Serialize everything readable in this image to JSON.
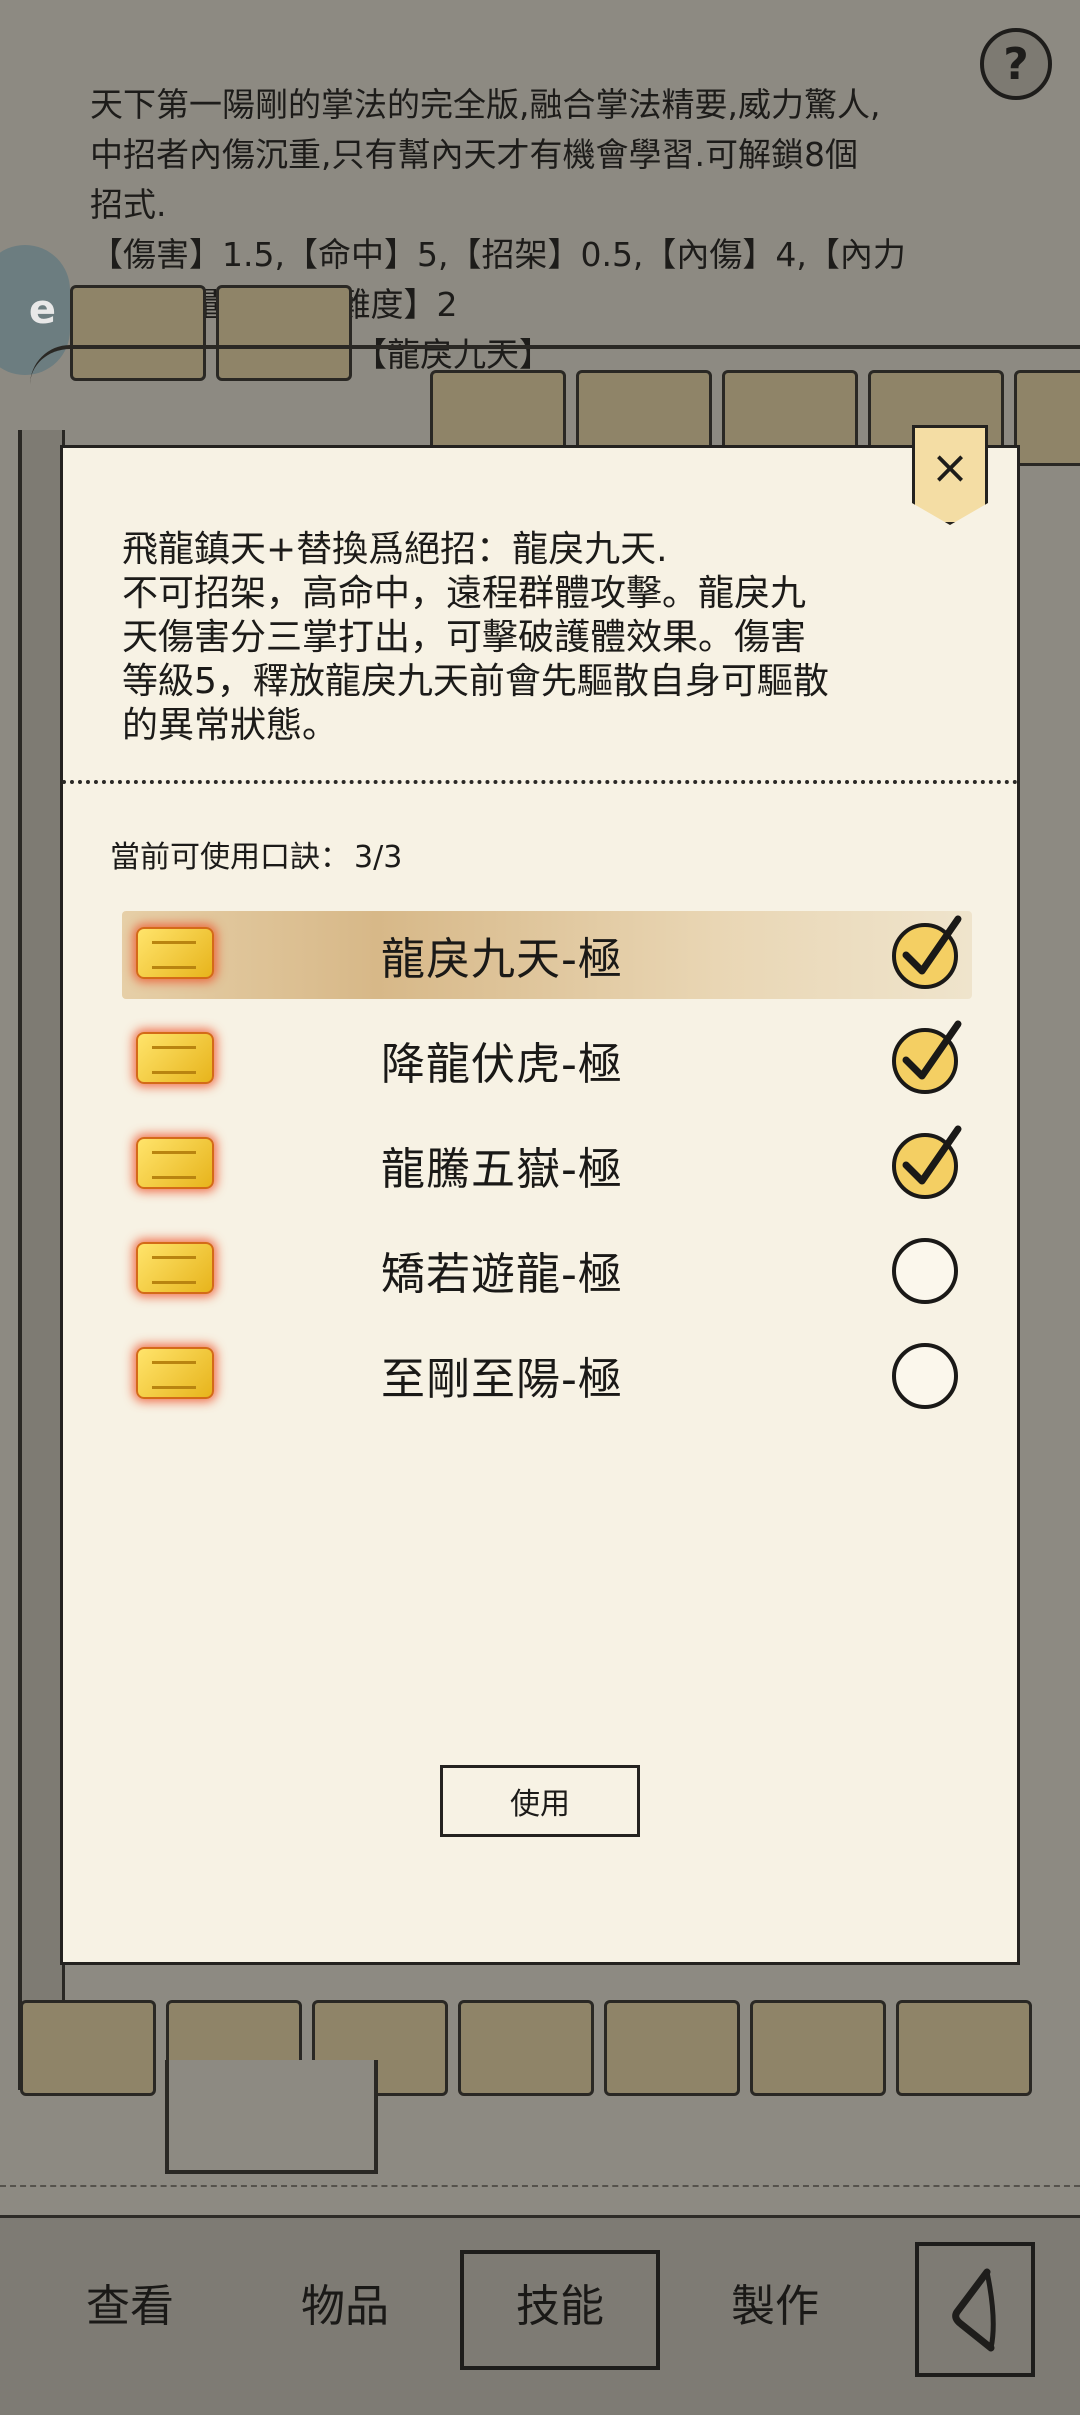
{
  "background": {
    "description_lines": [
      "天下第一陽剛的掌法的完全版,融合掌法精要,威力驚人,",
      "中招者內傷沉重,只有幫內天才有機會學習.可解鎖8個",
      "招式.",
      "【傷害】1.5,【命中】5,【招架】0.5,【內傷】4,【內力",
      "　　　量　【領悟難度】2",
      "　　　　　　岳】　【龍戾九天】"
    ],
    "help_label": "?",
    "side_badge_label": "e"
  },
  "dialog": {
    "close_label": "×",
    "description": [
      "飛龍鎮天+替換爲絕招：龍戾九天.",
      "不可招架，高命中，遠程群體攻擊。龍戾九",
      "天傷害分三掌打出，可擊破護體效果。傷害",
      "等級5，釋放龍戾九天前會先驅散自身可驅散",
      "的異常狀態。"
    ],
    "quota_label": "當前可使用口訣：",
    "quota_value": "3/3",
    "skills": [
      {
        "name": "龍戾九天-極",
        "checked": true,
        "highlighted": true
      },
      {
        "name": "降龍伏虎-極",
        "checked": true,
        "highlighted": false
      },
      {
        "name": "龍騰五嶽-極",
        "checked": true,
        "highlighted": false
      },
      {
        "name": "矯若遊龍-極",
        "checked": false,
        "highlighted": false
      },
      {
        "name": "至剛至陽-極",
        "checked": false,
        "highlighted": false
      }
    ],
    "use_button_label": "使用"
  },
  "bottom_nav": {
    "items": [
      "查看",
      "物品",
      "技能",
      "製作"
    ],
    "active": "技能"
  },
  "colors": {
    "check_fill": "#f4cf63",
    "highlight": "#d7b888",
    "dialog_bg": "#f7f2e4",
    "dim_bg": "#8d8a82"
  }
}
